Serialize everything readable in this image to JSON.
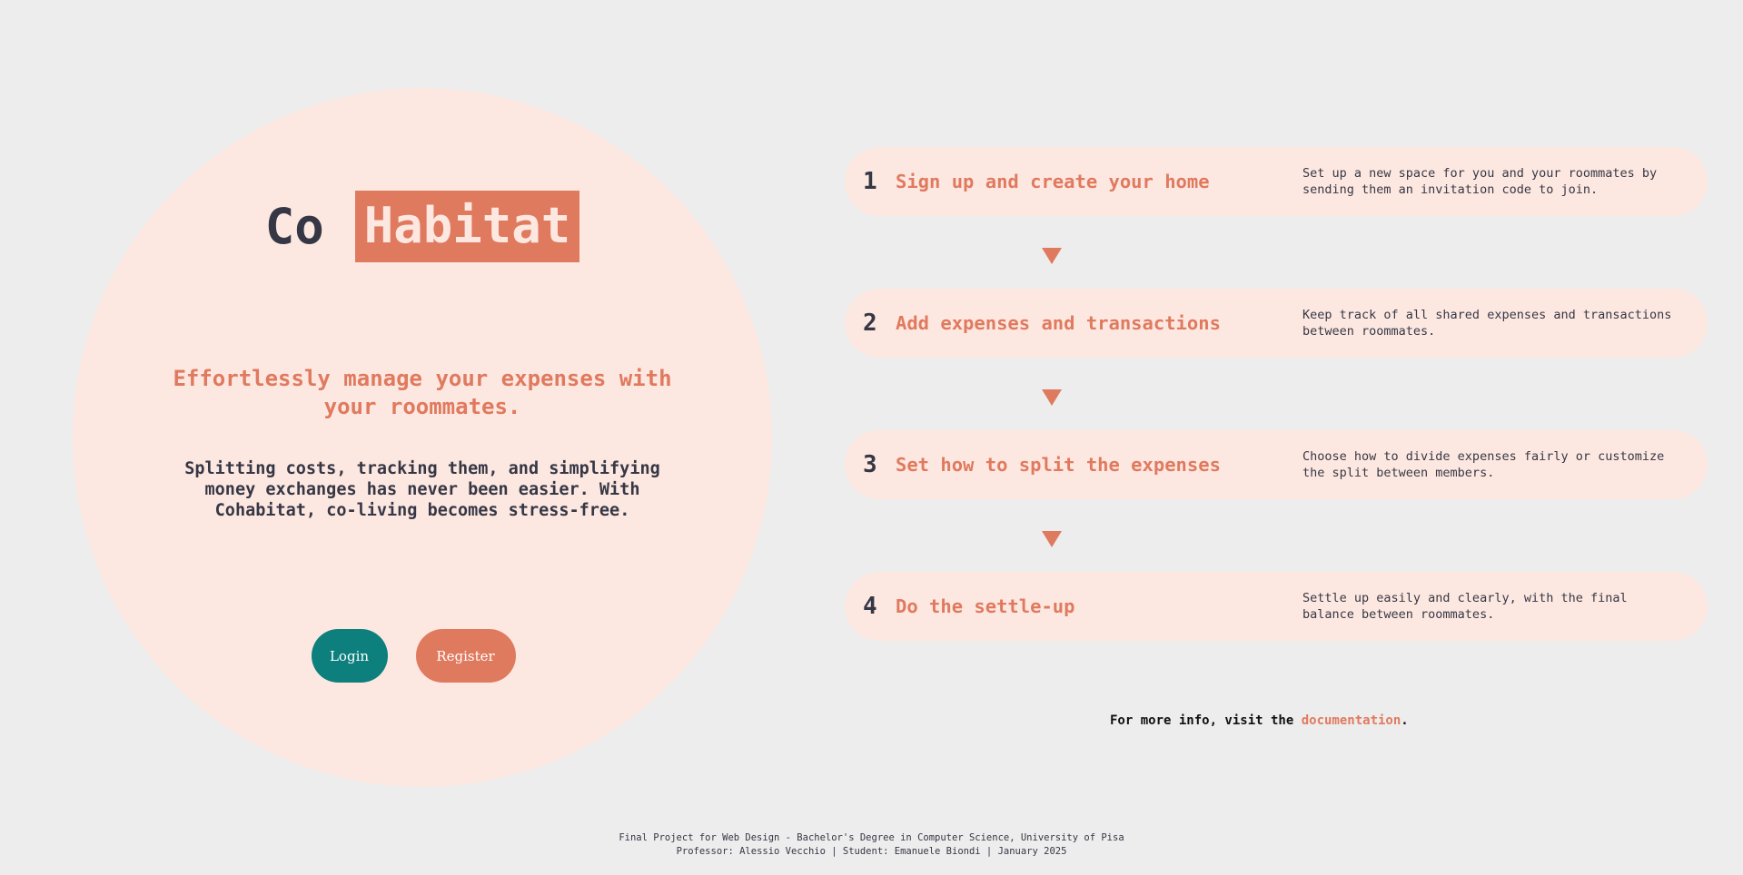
{
  "brand": {
    "part1": "Co",
    "part2": "Habitat"
  },
  "hero": {
    "tagline": "Effortlessly manage your expenses with your roommates.",
    "intro": "Splitting costs, tracking them, and simplifying money exchanges has never been easier. With Cohabitat, co-living becomes stress-free.",
    "login_label": "Login",
    "register_label": "Register"
  },
  "steps": [
    {
      "number": "1",
      "title": "Sign up and create your home",
      "description": "Set up a new space for you and your roommates by sending them an invitation code to join."
    },
    {
      "number": "2",
      "title": "Add expenses and transactions",
      "description": "Keep track of all shared expenses and transactions between roommates."
    },
    {
      "number": "3",
      "title": "Set how to split the expenses",
      "description": "Choose how to divide expenses fairly or customize the split between members."
    },
    {
      "number": "4",
      "title": "Do the settle-up",
      "description": "Settle up easily and clearly, with the final balance between roommates."
    }
  ],
  "more_info": {
    "prefix": "For more info, visit the ",
    "link_label": "documentation",
    "suffix": "."
  },
  "footer": {
    "line1": "Final Project for Web Design - Bachelor's Degree in Computer Science, University of Pisa",
    "line2": "Professor: Alessio Vecchio | Student: Emanuele Biondi | January 2025"
  },
  "colors": {
    "background": "#ededed",
    "panel": "#fde8e1",
    "accent": "#e07a5f",
    "teal": "#0d7f7d",
    "text_dark": "#363745"
  },
  "icons": {
    "step_arrow": "triangle-down-icon"
  }
}
